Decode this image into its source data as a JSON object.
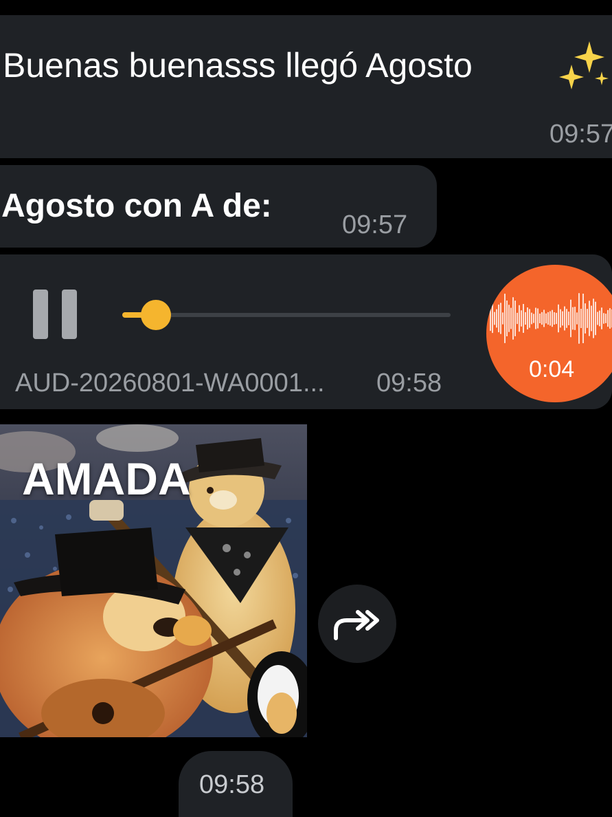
{
  "messages": [
    {
      "text": "Buenas buenasss llegó Agosto",
      "emoji": "sparkles-icon",
      "time": "09:57"
    },
    {
      "text": "Agosto con A de:",
      "time": "09:57"
    }
  ],
  "audio": {
    "file_name": "AUD-20260801-WA0001...",
    "time": "09:58",
    "duration": "0:04",
    "state": "playing",
    "progress": 0.08,
    "accent_color": "#f5b52e",
    "wave_color": "#f4652b"
  },
  "sticker": {
    "caption": "AMADA",
    "time": "09:58"
  },
  "colors": {
    "bubble": "#1f2226",
    "background": "#000000",
    "timestamp": "#9a9ea3"
  }
}
